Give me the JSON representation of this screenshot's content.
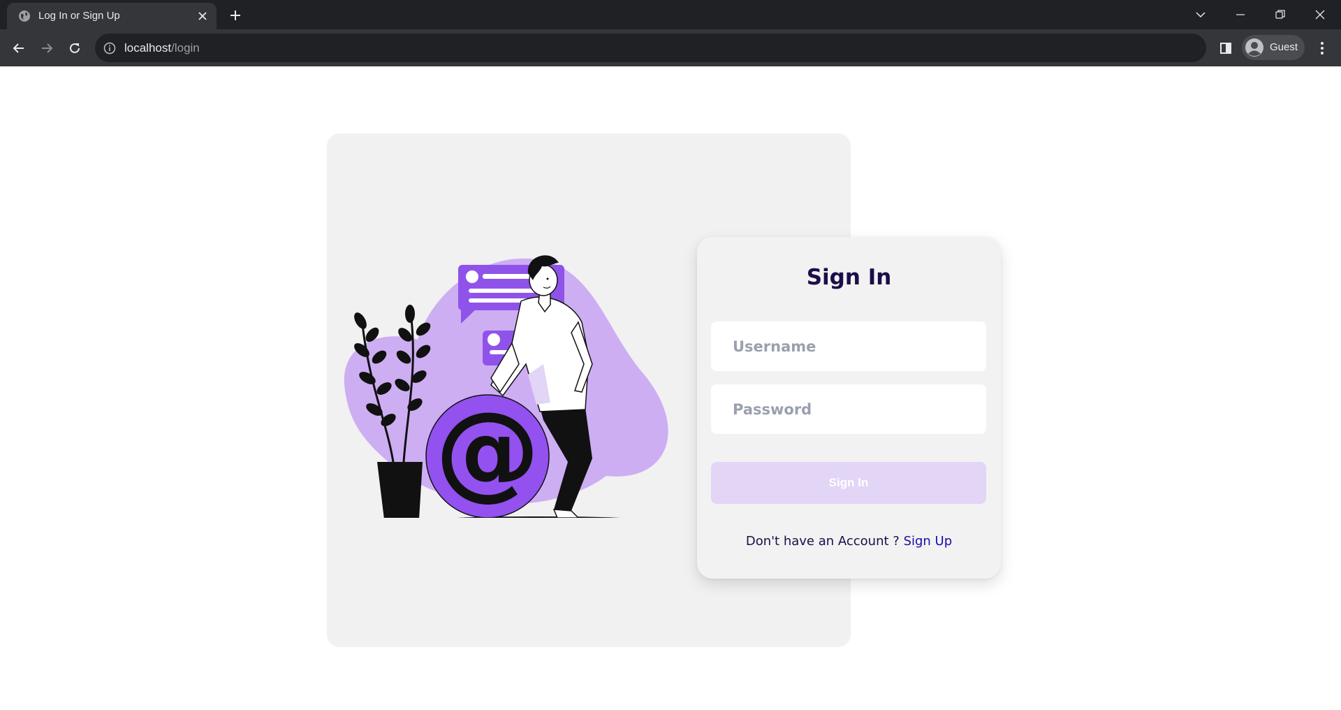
{
  "browser": {
    "tab": {
      "title": "Log In or Sign Up"
    },
    "address_bar": {
      "host": "localhost",
      "path": "/login"
    },
    "profile": {
      "name": "Guest"
    },
    "colors": {
      "frame": "#202124",
      "toolbar": "#35363a"
    }
  },
  "page": {
    "illustration": {
      "symbol": "@",
      "description_icons": [
        "plant",
        "chat-bubble",
        "at-sign-ball",
        "man-leaning"
      ]
    },
    "signin": {
      "title": "Sign In",
      "username_placeholder": "Username",
      "password_placeholder": "Password",
      "button_label": "Sign In",
      "no_account_text": "Don't have an Account ?",
      "signup_link_label": "Sign Up"
    },
    "colors": {
      "accent": "#9351f0",
      "accent_light": "#cdaef3",
      "button_disabled": "#e3d5f5",
      "title": "#1d0d48",
      "link": "#1a0dab"
    }
  }
}
